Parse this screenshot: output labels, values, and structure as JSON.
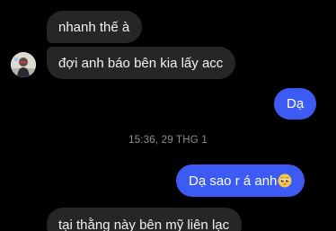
{
  "messages": [
    {
      "side": "in",
      "text": "nhanh thế à"
    },
    {
      "side": "in",
      "text": "đợi anh báo bên kia lấy acc"
    },
    {
      "side": "out",
      "text": "Dạ"
    },
    {
      "side": "out",
      "text": "Dạ sao r á anh",
      "emoji": "pleading-face-emoji"
    },
    {
      "side": "in",
      "text": "tại thằng này bên mỹ liên lạc"
    }
  ],
  "timestamp": "15:36, 29 THG 1",
  "colors": {
    "background": "#000000",
    "incoming_bubble": "#262626",
    "outgoing_bubble": "#3c5af4",
    "timestamp_text": "#8e8e93"
  }
}
